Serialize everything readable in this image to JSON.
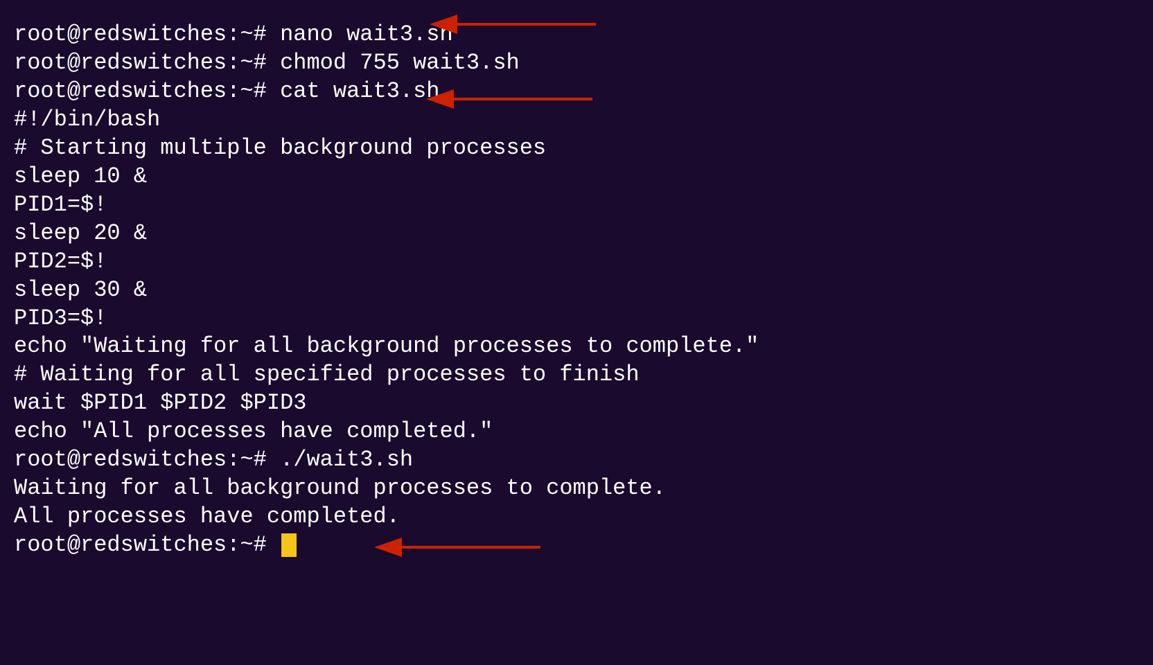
{
  "terminal": {
    "background": "#1a0a2e",
    "lines": [
      {
        "type": "prompt",
        "text": "root@redswitches:~# nano wait3.sh"
      },
      {
        "type": "prompt",
        "text": "root@redswitches:~# chmod 755 wait3.sh"
      },
      {
        "type": "prompt",
        "text": "root@redswitches:~# cat wait3.sh"
      },
      {
        "type": "code",
        "text": "#!/bin/bash"
      },
      {
        "type": "comment",
        "text": "# Starting multiple background processes"
      },
      {
        "type": "code",
        "text": "sleep 10 &"
      },
      {
        "type": "code",
        "text": "PID1=$!"
      },
      {
        "type": "code",
        "text": "sleep 20 &"
      },
      {
        "type": "code",
        "text": "PID2=$!"
      },
      {
        "type": "code",
        "text": "sleep 30 &"
      },
      {
        "type": "code",
        "text": "PID3=$!"
      },
      {
        "type": "code",
        "text": "echo \"Waiting for all background processes to complete.\""
      },
      {
        "type": "comment",
        "text": "# Waiting for all specified processes to finish"
      },
      {
        "type": "code",
        "text": "wait $PID1 $PID2 $PID3"
      },
      {
        "type": "code",
        "text": "echo \"All processes have completed.\""
      },
      {
        "type": "prompt",
        "text": "root@redswitches:~# ./wait3.sh"
      },
      {
        "type": "output",
        "text": "Waiting for all background processes to complete."
      },
      {
        "type": "output",
        "text": "All processes have completed."
      },
      {
        "type": "prompt-cursor",
        "text": "root@redswitches:~# "
      }
    ],
    "cursor_color": "#f5c518",
    "arrow_color": "#cc2200"
  }
}
